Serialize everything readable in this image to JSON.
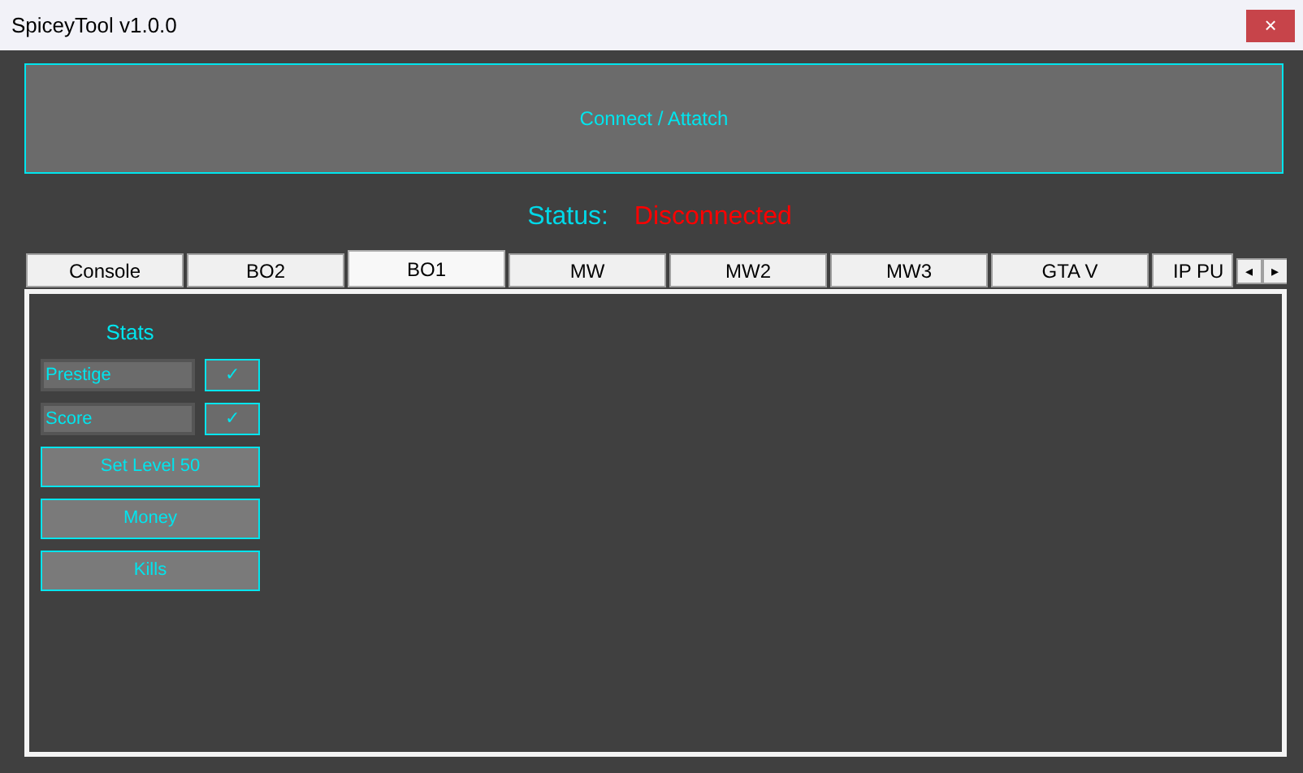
{
  "window": {
    "title": "SpiceyTool v1.0.0",
    "close": "×"
  },
  "connect_button": "Connect / Attatch",
  "status": {
    "label": "Status:",
    "value": "Disconnected"
  },
  "tabs": [
    {
      "label": "Console",
      "selected": false
    },
    {
      "label": "BO2",
      "selected": false
    },
    {
      "label": "BO1",
      "selected": true
    },
    {
      "label": "MW",
      "selected": false
    },
    {
      "label": "MW2",
      "selected": false
    },
    {
      "label": "MW3",
      "selected": false
    },
    {
      "label": "GTA V",
      "selected": false
    },
    {
      "label": "IP PU",
      "selected": false
    }
  ],
  "tab_scroll": [
    "◂",
    "▸"
  ],
  "stats": {
    "heading": "Stats",
    "fields": [
      {
        "value": "Prestige",
        "apply": "✓"
      },
      {
        "value": "Score",
        "apply": "✓"
      }
    ],
    "buttons": [
      "Set Level 50",
      "Money",
      "Kills"
    ]
  }
}
